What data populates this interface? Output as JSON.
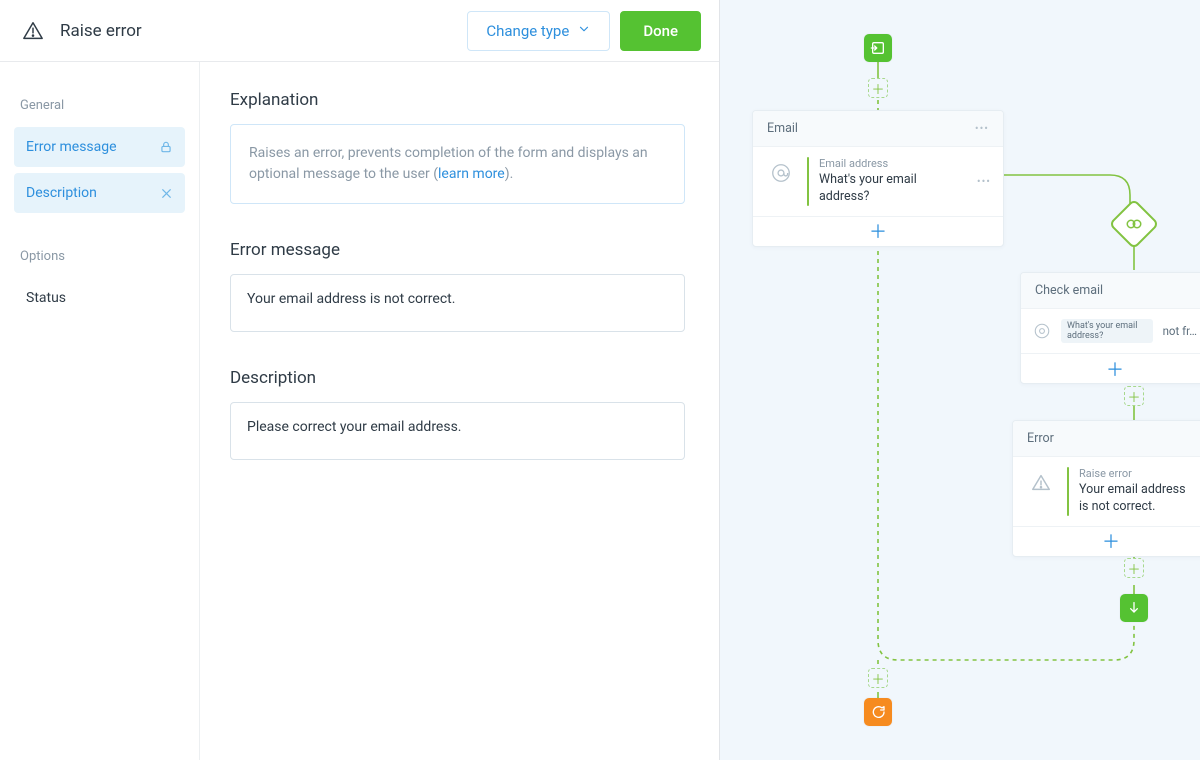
{
  "header": {
    "title": "Raise error",
    "change_type_label": "Change type",
    "done_label": "Done"
  },
  "sidebar": {
    "group_general": "General",
    "items": [
      {
        "label": "Error message",
        "icon": "lock"
      },
      {
        "label": "Description",
        "icon": "close"
      }
    ],
    "group_options": "Options",
    "option_items": [
      {
        "label": "Status"
      }
    ]
  },
  "main": {
    "explanation_title": "Explanation",
    "explanation_text_a": "Raises an error, prevents completion of the form and displays an optional message to the user (",
    "explanation_link": "learn more",
    "explanation_text_b": ").",
    "error_message_title": "Error message",
    "error_message_value": "Your email address is not correct.",
    "description_title": "Description",
    "description_value": "Please correct your email address."
  },
  "diagram": {
    "email_card": {
      "title": "Email",
      "row_kicker": "Email address",
      "row_title": "What's your email address?"
    },
    "check_card": {
      "title": "Check email",
      "chip": "What's your email address?",
      "after": "not fr…"
    },
    "error_card": {
      "title": "Error",
      "row_kicker": "Raise error",
      "row_title": "Your email address is not correct."
    }
  }
}
